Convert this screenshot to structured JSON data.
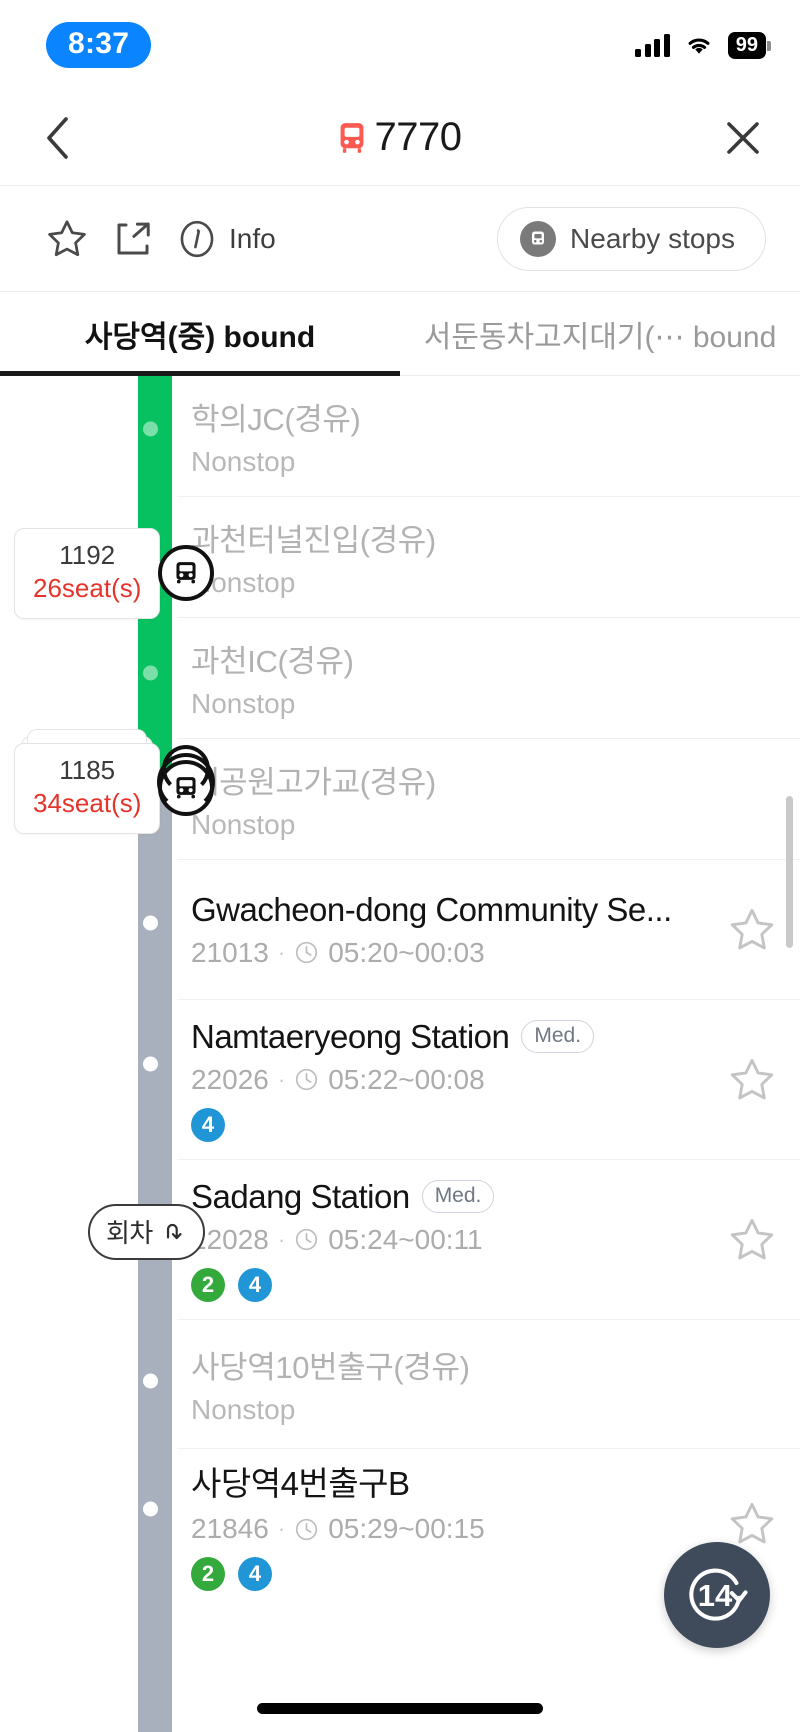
{
  "status_bar": {
    "time": "8:37",
    "battery": "99",
    "signal_icon": "cellular-signal-icon",
    "wifi_icon": "wifi-icon"
  },
  "nav": {
    "back_icon": "chevron-left-icon",
    "bus_icon": "bus-icon",
    "route_number": "7770",
    "close_icon": "close-icon"
  },
  "actions": {
    "favorite_icon": "star-outline-icon",
    "share_icon": "share-icon",
    "info_icon": "info-circle-icon",
    "info_label": "Info",
    "nearby_label": "Nearby stops",
    "nearby_icon": "bus-stop-icon"
  },
  "tabs": [
    {
      "label": "사당역(중) bound",
      "active": true
    },
    {
      "label": "서둔동차고지대기(⋯ bound",
      "active": false
    }
  ],
  "buses": [
    {
      "vehicle_id": "1192",
      "seats": "26seat(s)",
      "stacked": false
    },
    {
      "vehicle_id": "1185",
      "seats": "34seat(s)",
      "stacked": true
    }
  ],
  "turnaround": {
    "label": "회차",
    "icon": "turnaround-arrow-icon"
  },
  "stops": [
    {
      "type": "pass",
      "name": "학의JC(경유)",
      "sub": "Nonstop"
    },
    {
      "type": "pass",
      "name": "과천터널진입(경유)",
      "sub": "Nonstop"
    },
    {
      "type": "pass",
      "name": "과천IC(경유)",
      "sub": "Nonstop"
    },
    {
      "type": "pass",
      "name": "대공원고가교(경유)",
      "sub": "Nonstop"
    },
    {
      "type": "stop",
      "name": "Gwacheon-dong Community Se...",
      "code": "21013",
      "hours": "05:20~00:03",
      "chip": "",
      "lines": [],
      "star_icon": "star-outline-icon"
    },
    {
      "type": "stop",
      "name": "Namtaeryeong Station",
      "code": "22026",
      "hours": "05:22~00:08",
      "chip": "Med.",
      "lines": [
        {
          "no": "4",
          "color": "#2196d6"
        }
      ],
      "star_icon": "star-outline-icon"
    },
    {
      "type": "stop",
      "name": "Sadang Station",
      "code": "22028",
      "hours": "05:24~00:11",
      "chip": "Med.",
      "lines": [
        {
          "no": "2",
          "color": "#34a93c"
        },
        {
          "no": "4",
          "color": "#2196d6"
        }
      ],
      "star_icon": "star-outline-icon"
    },
    {
      "type": "pass",
      "name": "사당역10번출구(경유)",
      "sub": "Nonstop"
    },
    {
      "type": "stop",
      "name": "사당역4번출구B",
      "code": "21846",
      "hours": "05:29~00:15",
      "chip": "",
      "lines": [
        {
          "no": "2",
          "color": "#34a93c"
        },
        {
          "no": "4",
          "color": "#2196d6"
        }
      ],
      "star_icon": "star-outline-icon"
    }
  ],
  "refresh_fab": {
    "count": "14",
    "icon": "refresh-circular-arrow-icon"
  },
  "colors": {
    "accent_blue": "#0a84ff",
    "route_active_green": "#07c160",
    "route_inactive_grey": "#a8b0bd",
    "seat_red": "#e5342b",
    "fab_bg": "#3f4a5a"
  }
}
